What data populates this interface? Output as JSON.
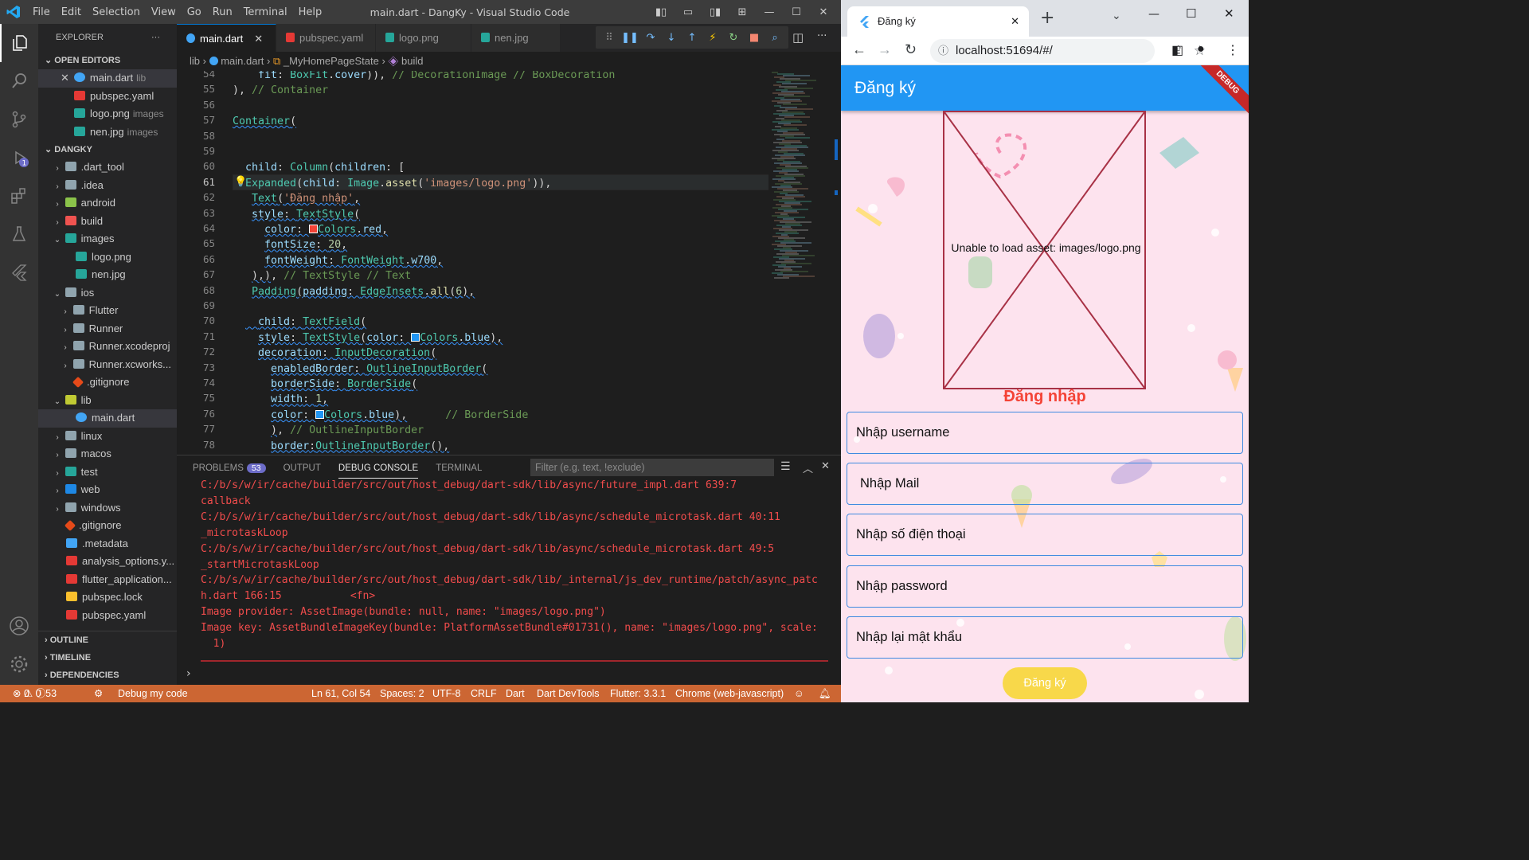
{
  "vscode": {
    "menu": [
      "File",
      "Edit",
      "Selection",
      "View",
      "Go",
      "Run",
      "Terminal",
      "Help"
    ],
    "window_title": "main.dart - DangKy - Visual Studio Code",
    "explorer_title": "EXPLORER",
    "open_editors_label": "OPEN EDITORS",
    "open_editors": [
      {
        "name": "main.dart",
        "hint": "lib"
      },
      {
        "name": "pubspec.yaml",
        "hint": ""
      },
      {
        "name": "logo.png",
        "hint": "images"
      },
      {
        "name": "nen.jpg",
        "hint": "images"
      }
    ],
    "project_label": "DANGKY",
    "tree": [
      ".dart_tool",
      ".idea",
      "android",
      "build",
      "images",
      "logo.png",
      "nen.jpg",
      "ios",
      "Flutter",
      "Runner",
      "Runner.xcodeproj",
      "Runner.xcworks...",
      ".gitignore",
      "lib",
      "main.dart",
      "linux",
      "macos",
      "test",
      "web",
      "windows",
      ".gitignore",
      ".metadata",
      "analysis_options.y...",
      "flutter_application...",
      "pubspec.lock",
      "pubspec.yaml"
    ],
    "outline_label": "OUTLINE",
    "timeline_label": "TIMELINE",
    "dependencies_label": "DEPENDENCIES",
    "tabs": [
      "main.dart",
      "pubspec.yaml",
      "logo.png",
      "nen.jpg"
    ],
    "breadcrumb": {
      "a": "lib",
      "b": "main.dart",
      "c": "_MyHomePageState",
      "d": "build"
    },
    "line_numbers": [
      "54",
      "55",
      "56",
      "57",
      "58",
      "59",
      "60",
      "61",
      "62",
      "63",
      "64",
      "65",
      "66",
      "67",
      "68",
      "69",
      "70",
      "71",
      "72",
      "73",
      "74",
      "75",
      "76",
      "77",
      "78"
    ],
    "panel_tabs": {
      "problems": "PROBLEMS",
      "problems_count": "53",
      "output": "OUTPUT",
      "debug_console": "DEBUG CONSOLE",
      "terminal": "TERMINAL"
    },
    "filter_placeholder": "Filter (e.g. text, !exclude)",
    "console_lines": [
      "C:/b/s/w/ir/cache/builder/src/out/host_debug/dart-sdk/lib/async/future_impl.dart 639:7",
      "callback",
      "C:/b/s/w/ir/cache/builder/src/out/host_debug/dart-sdk/lib/async/schedule_microtask.dart 40:11",
      "_microtaskLoop",
      "C:/b/s/w/ir/cache/builder/src/out/host_debug/dart-sdk/lib/async/schedule_microtask.dart 49:5",
      "_startMicrotaskLoop",
      "C:/b/s/w/ir/cache/builder/src/out/host_debug/dart-sdk/lib/_internal/js_dev_runtime/patch/async_patc",
      "h.dart 166:15           <fn>",
      "Image provider: AssetImage(bundle: null, name: \"images/logo.png\")",
      "Image key: AssetBundleImageKey(bundle: PlatformAssetBundle#01731(), name: \"images/logo.png\", scale:",
      "  1)"
    ],
    "status": {
      "errors": "0",
      "warnings": "0",
      "infos": "53",
      "debug": "Debug my code",
      "position": "Ln 61, Col 54",
      "spaces": "Spaces: 2",
      "encoding": "UTF-8",
      "eol": "CRLF",
      "lang": "Dart",
      "devtools": "Dart DevTools",
      "flutter": "Flutter: 3.3.1",
      "device": "Chrome (web-javascript)"
    },
    "status_color": "#cc6633"
  },
  "browser": {
    "tab_title": "Đăng ký",
    "url": "localhost:51694/#/",
    "app": {
      "appbar_title": "Đăng ký",
      "debug_banner": "DEBUG",
      "image_error": "Unable to load asset: images/logo.png",
      "heading": "Đăng nhập",
      "fields": [
        "Nhập username",
        "Nhập Mail",
        "Nhập số điện thoại",
        "Nhập password",
        "Nhập lại mật khẩu"
      ],
      "button": "Đăng ký",
      "appbar_color": "#2196f3",
      "heading_color": "#f44336",
      "button_color": "#f8d84a"
    }
  }
}
